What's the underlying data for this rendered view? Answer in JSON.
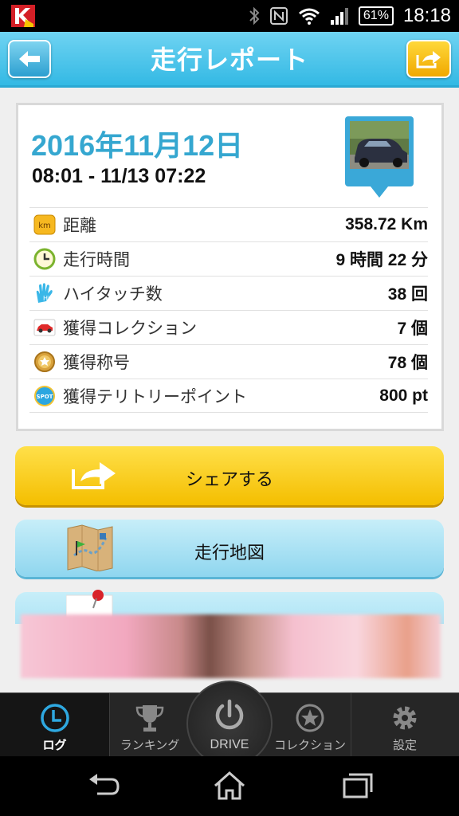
{
  "status_bar": {
    "battery": "61%",
    "time": "18:18"
  },
  "header": {
    "title": "走行レポート"
  },
  "report": {
    "date": "2016年11月12日",
    "range": "08:01 - 11/13 07:22",
    "stats": [
      {
        "icon": "km-icon",
        "label": "距離",
        "value": "358.72 Km"
      },
      {
        "icon": "clock-icon",
        "label": "走行時間",
        "value": "9 時間 22 分"
      },
      {
        "icon": "high-touch-hand-icon",
        "label": "ハイタッチ数",
        "value": "38 回"
      },
      {
        "icon": "car-collection-icon",
        "label": "獲得コレクション",
        "value": "7 個"
      },
      {
        "icon": "medal-icon",
        "label": "獲得称号",
        "value": "78 個"
      },
      {
        "icon": "spot-icon",
        "label": "獲得テリトリーポイント",
        "value": "800 pt"
      }
    ],
    "km_icon_text": "km",
    "spot_icon_text": "SPOT"
  },
  "buttons": {
    "share": "シェアする",
    "map": "走行地図"
  },
  "tabs": {
    "log": "ログ",
    "ranking": "ランキング",
    "drive": "DRIVE",
    "collection": "コレクション",
    "settings": "設定"
  },
  "colors": {
    "header_blue": "#33b9e4",
    "date_blue": "#35a7d0",
    "share_yellow": "#f4be00",
    "map_blue": "#8fd6ef"
  }
}
